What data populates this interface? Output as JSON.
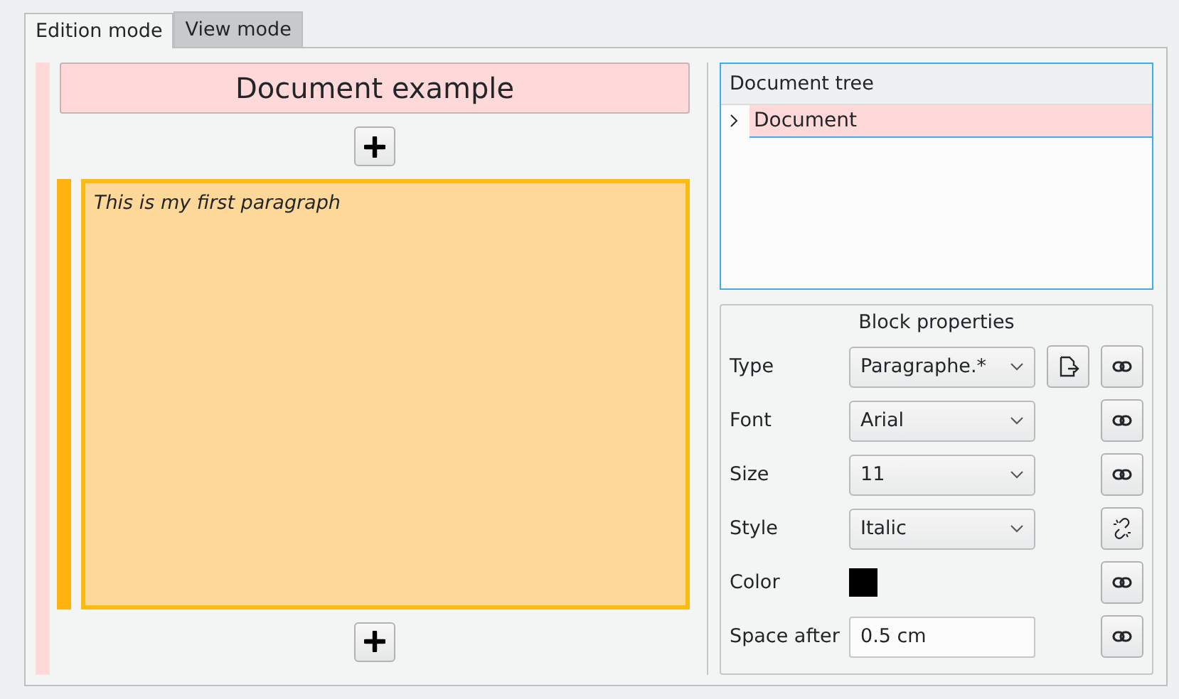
{
  "tabs": [
    {
      "label": "Edition mode",
      "selected": true
    },
    {
      "label": "View mode",
      "selected": false
    }
  ],
  "document": {
    "title": "Document example",
    "blocks": [
      {
        "text": "This is my first paragraph"
      }
    ]
  },
  "tree": {
    "header": "Document tree",
    "items": [
      {
        "label": "Document",
        "selected": true,
        "expanded": false
      }
    ]
  },
  "properties": {
    "title": "Block properties",
    "rows": [
      {
        "label": "Type",
        "kind": "combo",
        "value": "Paragraphe.*",
        "extra_button": true,
        "linked": true
      },
      {
        "label": "Font",
        "kind": "combo",
        "value": "Arial",
        "extra_button": false,
        "linked": true
      },
      {
        "label": "Size",
        "kind": "combo",
        "value": "11",
        "extra_button": false,
        "linked": true
      },
      {
        "label": "Style",
        "kind": "combo",
        "value": "Italic",
        "extra_button": false,
        "linked": false
      },
      {
        "label": "Color",
        "kind": "color",
        "color": "#000000",
        "extra_button": false,
        "linked": true
      },
      {
        "label": "Space after",
        "kind": "field",
        "value": "0.5 cm",
        "extra_button": false,
        "linked": true
      }
    ]
  }
}
